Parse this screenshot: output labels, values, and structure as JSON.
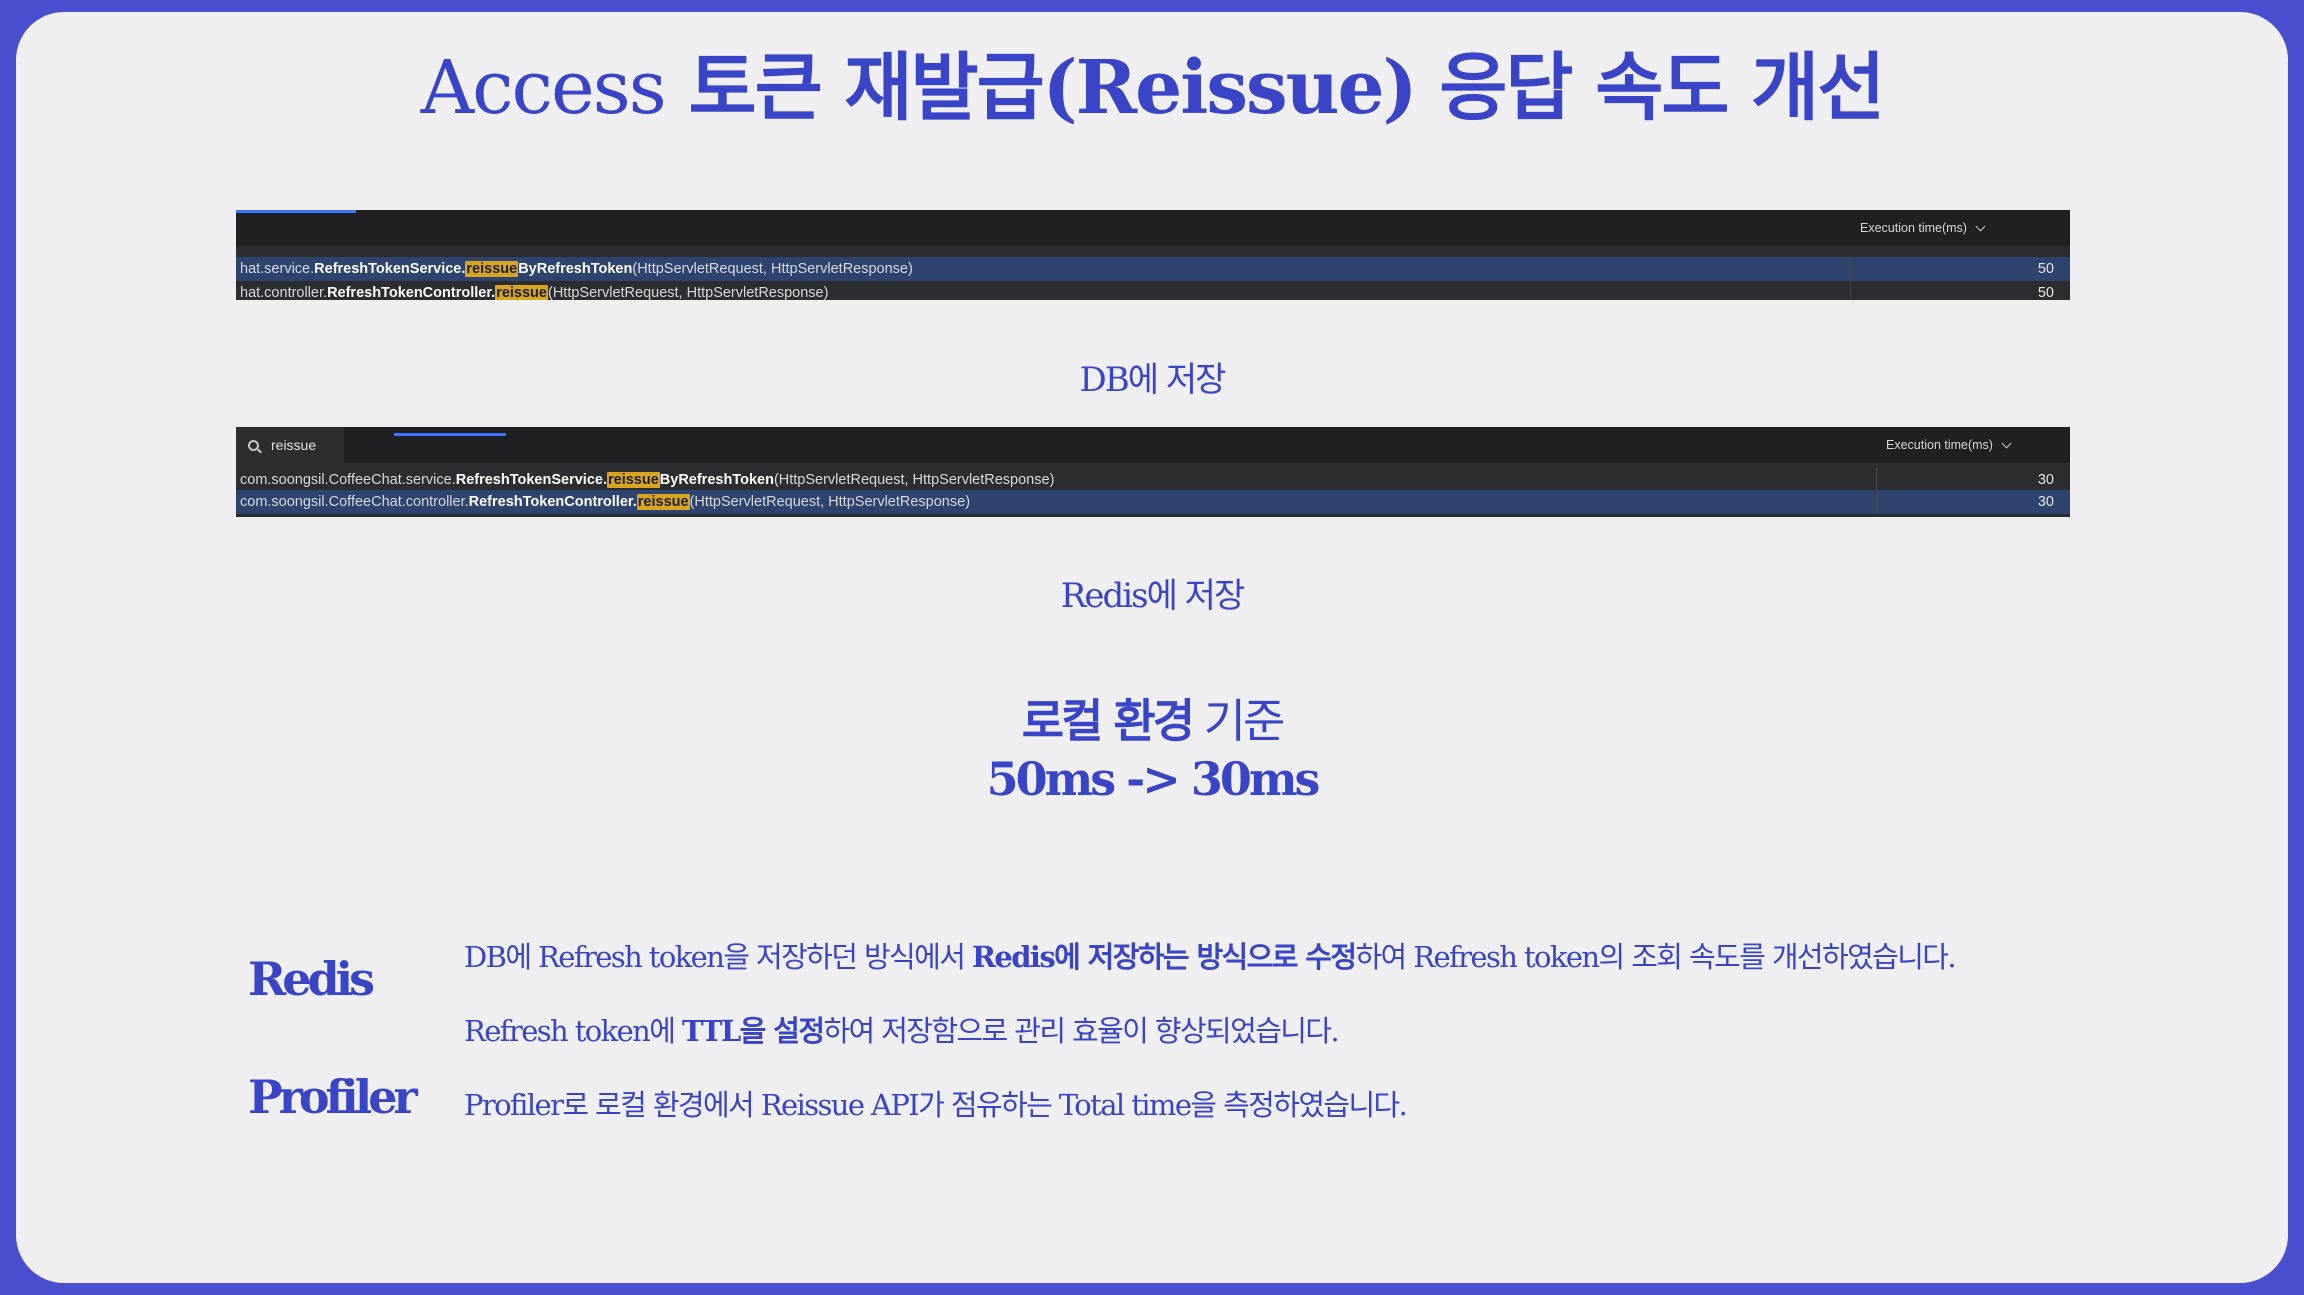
{
  "title": {
    "en": "Access",
    "ko": "토큰 재발급(Reissue) 응답 속도 개선"
  },
  "panel_db": {
    "column_header": "Execution time(ms)",
    "rows": [
      {
        "prefix": "hat.service.",
        "class": "RefreshTokenService.",
        "hl": "reissue",
        "bold_suffix": "ByRefreshToken",
        "params": "(HttpServletRequest, HttpServletResponse)",
        "time": "50"
      },
      {
        "prefix": "hat.controller.",
        "class": "RefreshTokenController.",
        "hl": "reissue",
        "bold_suffix": "",
        "params": "(HttpServletRequest, HttpServletResponse)",
        "time": "50"
      }
    ],
    "caption": "DB에 저장"
  },
  "panel_redis": {
    "search_value": "reissue",
    "column_header": "Execution time(ms)",
    "rows": [
      {
        "prefix": "com.soongsil.CoffeeChat.service.",
        "class": "RefreshTokenService.",
        "hl": "reissue",
        "bold_suffix": "ByRefreshToken",
        "params": "(HttpServletRequest, HttpServletResponse)",
        "time": "30"
      },
      {
        "prefix": "com.soongsil.CoffeeChat.controller.",
        "class": "RefreshTokenController.",
        "hl": "reissue",
        "bold_suffix": "",
        "params": "(HttpServletRequest, HttpServletResponse)",
        "time": "30"
      }
    ],
    "caption": "Redis에 저장"
  },
  "summary": {
    "bold": "로컬 환경",
    "rest": " 기준",
    "result": "50ms -> 30ms"
  },
  "details": [
    {
      "label": "Redis"
    },
    {
      "label": "Profiler"
    }
  ],
  "lines": {
    "d1_a": "DB에 Refresh token을 저장하던 방식에서 ",
    "d1_b": "Redis에 저장하는 방식으로 수정",
    "d1_c": "하여 Refresh token의 조회 속도를 개선하였습니다.",
    "d2_a": "Refresh token에 ",
    "d2_b": "TTL을 설정",
    "d2_c": "하여 저장함으로 관리 효율이 향상되었습니다.",
    "d3": "Profiler로 로컬 환경에서 Reissue API가 점유하는 Total time을 측정하였습니다."
  }
}
